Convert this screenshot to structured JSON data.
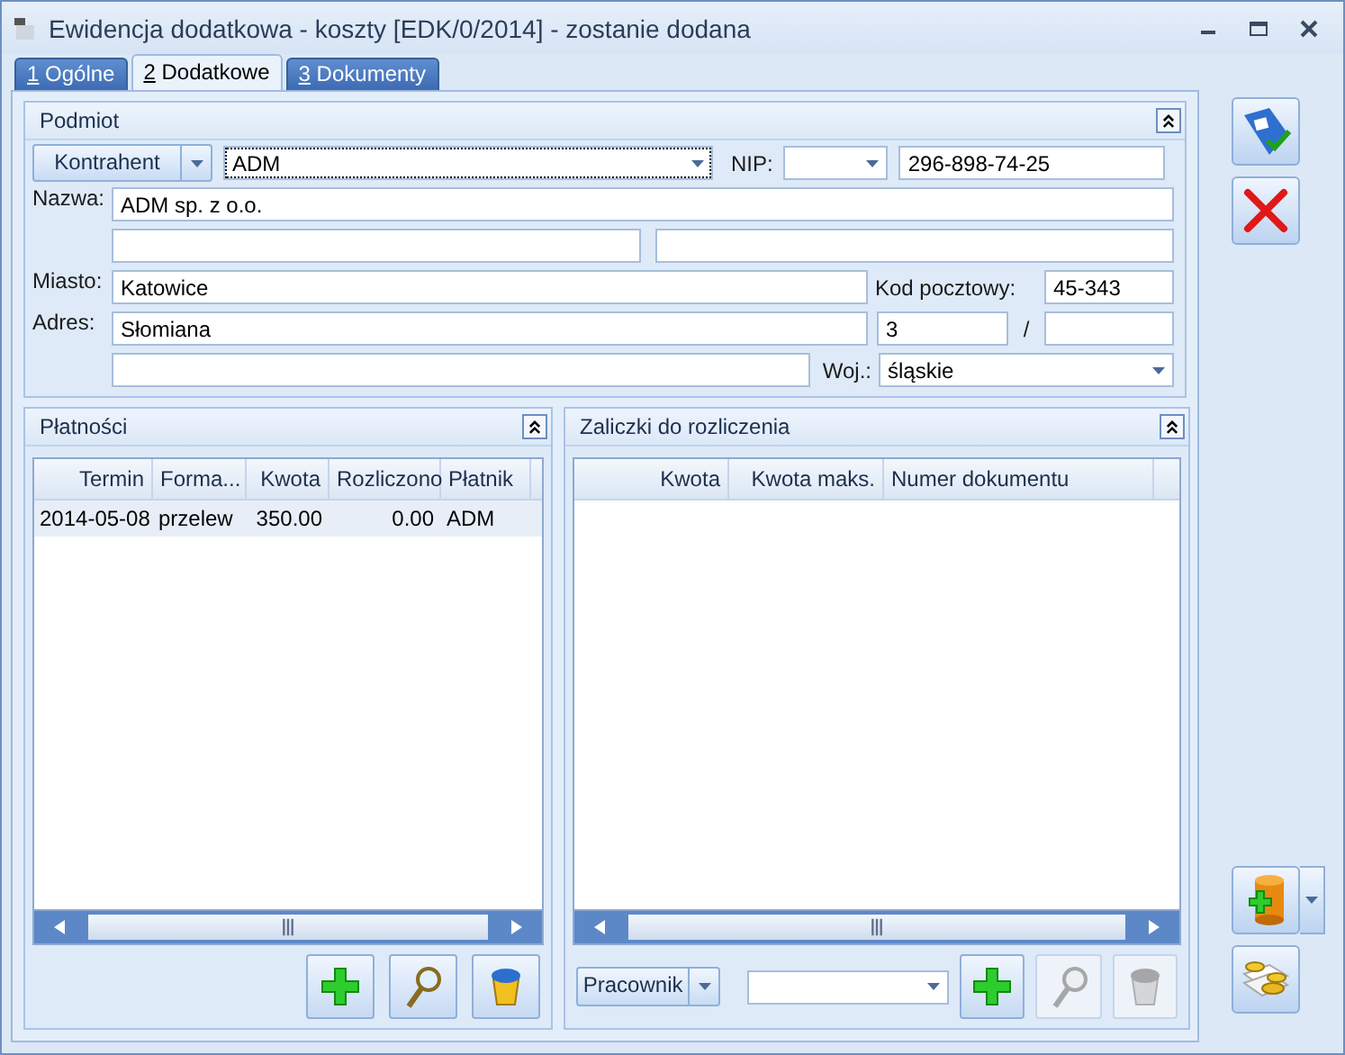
{
  "window": {
    "title": "Ewidencja dodatkowa - koszty [EDK/0/2014] - zostanie dodana"
  },
  "tabs": [
    {
      "key": "1",
      "label": "Ogólne",
      "selected": false
    },
    {
      "key": "2",
      "label": "Dodatkowe",
      "selected": true
    },
    {
      "key": "3",
      "label": "Dokumenty",
      "selected": false
    }
  ],
  "podmiot": {
    "title": "Podmiot",
    "type_button": "Kontrahent",
    "contractor": "ADM",
    "nip_label": "NIP:",
    "nip": "296-898-74-25",
    "name_label": "Nazwa:",
    "name": "ADM sp. z o.o.",
    "city_label": "Miasto:",
    "city": "Katowice",
    "postcode_label": "Kod pocztowy:",
    "postcode": "45-343",
    "address_label": "Adres:",
    "street": "Słomiana",
    "house_no": "3",
    "separator": "/",
    "province_label": "Woj.:",
    "province": "śląskie"
  },
  "payments": {
    "title": "Płatności",
    "columns": [
      "Termin",
      "Forma...",
      "Kwota",
      "Rozliczono",
      "Płatnik"
    ],
    "rows": [
      {
        "cells": [
          "2014-05-08",
          "przelew",
          "350.00",
          "0.00",
          "ADM"
        ],
        "selected": true
      }
    ],
    "buttons": [
      {
        "kind": "add",
        "disabled": false
      },
      {
        "kind": "view",
        "disabled": false
      },
      {
        "kind": "delete",
        "disabled": false
      }
    ]
  },
  "advances": {
    "title": "Zaliczki do rozliczenia",
    "columns": [
      "Kwota",
      "Kwota maks.",
      "Numer dokumentu"
    ],
    "filter_button": "Pracownik",
    "buttons": [
      {
        "kind": "add",
        "disabled": false
      },
      {
        "kind": "view",
        "disabled": true
      },
      {
        "kind": "delete",
        "disabled": true
      }
    ]
  },
  "toolbar_top": [
    {
      "kind": "save"
    },
    {
      "kind": "cancel"
    }
  ],
  "toolbar_bottom": [
    {
      "kind": "add-document"
    },
    {
      "kind": "coins"
    }
  ]
}
